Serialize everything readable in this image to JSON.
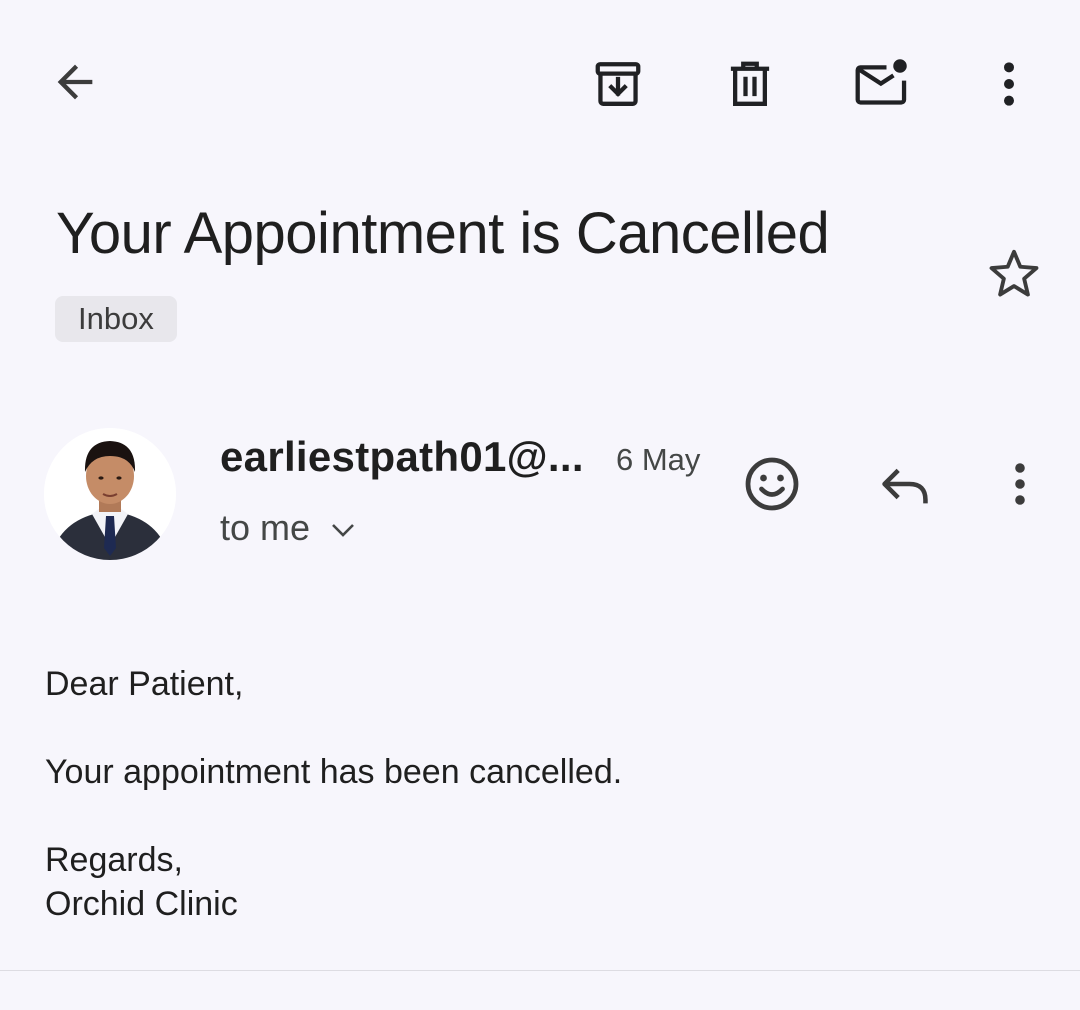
{
  "toolbar": {
    "back_icon": "arrow-back-icon",
    "archive_icon": "archive-icon",
    "delete_icon": "trash-icon",
    "unread_icon": "mark-unread-icon",
    "more_icon": "more-vert-icon"
  },
  "email": {
    "subject": "Your Appointment is Cancelled",
    "label": "Inbox",
    "starred": false,
    "sender": "earliestpath01@...",
    "date": "6 May",
    "recipient": "to me",
    "body": {
      "greeting": "Dear Patient,",
      "message": "Your appointment has been cancelled.",
      "closing": "Regards,",
      "signature": "Orchid Clinic"
    }
  },
  "message_actions": {
    "emoji_icon": "add-reaction-icon",
    "reply_icon": "reply-icon",
    "more_icon": "more-vert-icon"
  },
  "colors": {
    "background": "#f7f6fc",
    "text": "#1f1f1f",
    "secondary_text": "#444746",
    "chip_background": "#e8e7ec",
    "icon": "#202124"
  }
}
